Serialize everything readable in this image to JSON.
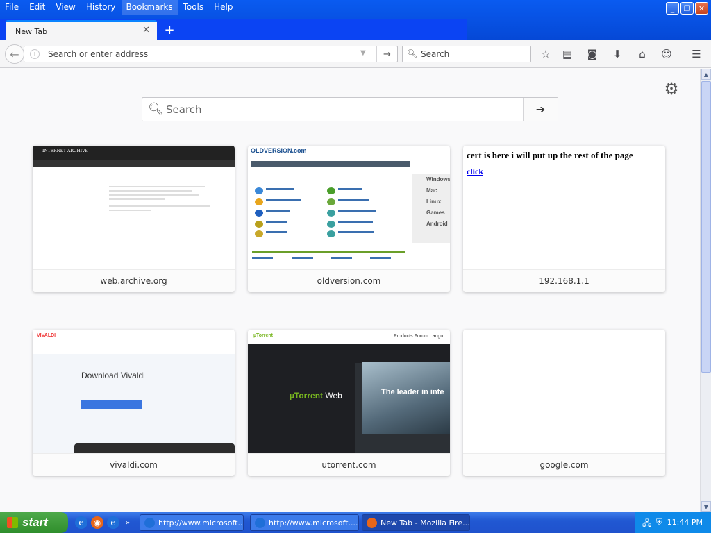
{
  "menubar": {
    "items": [
      "File",
      "Edit",
      "View",
      "History",
      "Bookmarks",
      "Tools",
      "Help"
    ],
    "active_index": 4
  },
  "tab": {
    "title": "New Tab"
  },
  "navbar": {
    "url_placeholder": "Search or enter address",
    "search_placeholder": "Search"
  },
  "newtab": {
    "search_placeholder": "Search",
    "tiles": [
      {
        "label": "web.archive.org"
      },
      {
        "label": "oldversion.com"
      },
      {
        "label": "192.168.1.1"
      },
      {
        "label": "vivaldi.com"
      },
      {
        "label": "utorrent.com"
      },
      {
        "label": "google.com"
      }
    ],
    "thumb_texts": {
      "archive_logo": "INTERNET ARCHIVE",
      "oldversion_logo": "OLDVERSION.com",
      "oldversion_side": [
        "Windows",
        "Mac",
        "Linux",
        "Games",
        "Android"
      ],
      "router_text": "cert is here i will put up the rest of the page",
      "router_link": "click",
      "vivaldi_logo": "VIVALDI",
      "vivaldi_heading": "Download Vivaldi",
      "utorrent_logo": "µTorrent",
      "utorrent_nav": "Products    Forum    Langu",
      "utorrent_web_a": "µTorrent",
      "utorrent_web_b": "Web",
      "utorrent_lead": "The leader in inte"
    }
  },
  "taskbar": {
    "start_label": "start",
    "tasks": [
      {
        "label": "http://www.microsoft...."
      },
      {
        "label": "http://www.microsoft...."
      },
      {
        "label": "New Tab - Mozilla Fire..."
      }
    ],
    "clock": "11:44 PM"
  },
  "colors": {
    "title_bar": "#0a5bf0",
    "tab_accent": "#0a84ff",
    "taskbar": "#2158d2",
    "start_button": "#2f8e2c",
    "tray": "#0f8ae9"
  }
}
